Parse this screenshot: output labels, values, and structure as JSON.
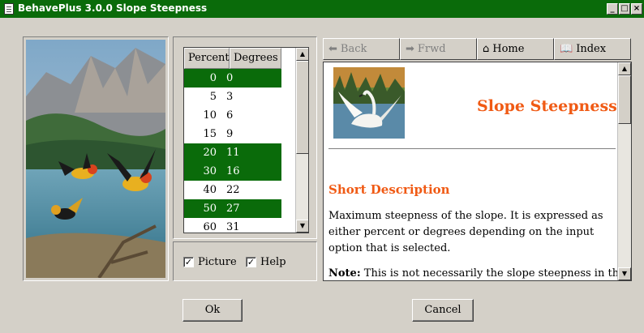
{
  "window": {
    "title": "BehavePlus 3.0.0 Slope Steepness",
    "minimize": "_",
    "maximize": "□",
    "close": "×"
  },
  "table": {
    "headers": [
      "Percent",
      "Degrees"
    ],
    "rows": [
      {
        "percent": "0",
        "degrees": "0",
        "selected": true
      },
      {
        "percent": "5",
        "degrees": "3",
        "selected": false
      },
      {
        "percent": "10",
        "degrees": "6",
        "selected": false
      },
      {
        "percent": "15",
        "degrees": "9",
        "selected": false
      },
      {
        "percent": "20",
        "degrees": "11",
        "selected": true
      },
      {
        "percent": "30",
        "degrees": "16",
        "selected": true
      },
      {
        "percent": "40",
        "degrees": "22",
        "selected": false
      },
      {
        "percent": "50",
        "degrees": "27",
        "selected": true
      },
      {
        "percent": "60",
        "degrees": "31",
        "selected": false
      }
    ]
  },
  "options": {
    "picture_label": "Picture",
    "picture_checked": true,
    "help_label": "Help",
    "help_checked": true
  },
  "nav": {
    "back": "Back",
    "forward": "Frwd",
    "home": "Home",
    "index": "Index"
  },
  "help": {
    "title": "Slope Steepness",
    "heading": "Short Description",
    "paragraph": "Maximum steepness of the slope. It is expressed as either percent or degrees depending on the input option that is selected.",
    "note_label": "Note:",
    "note_text": " This is not necessarily the slope steepness in the"
  },
  "buttons": {
    "ok": "Ok",
    "cancel": "Cancel"
  },
  "colors": {
    "titlebar": "#0a6b0a",
    "selection": "#0a6b0a",
    "heading": "#f05a14",
    "face": "#d4d0c8"
  }
}
